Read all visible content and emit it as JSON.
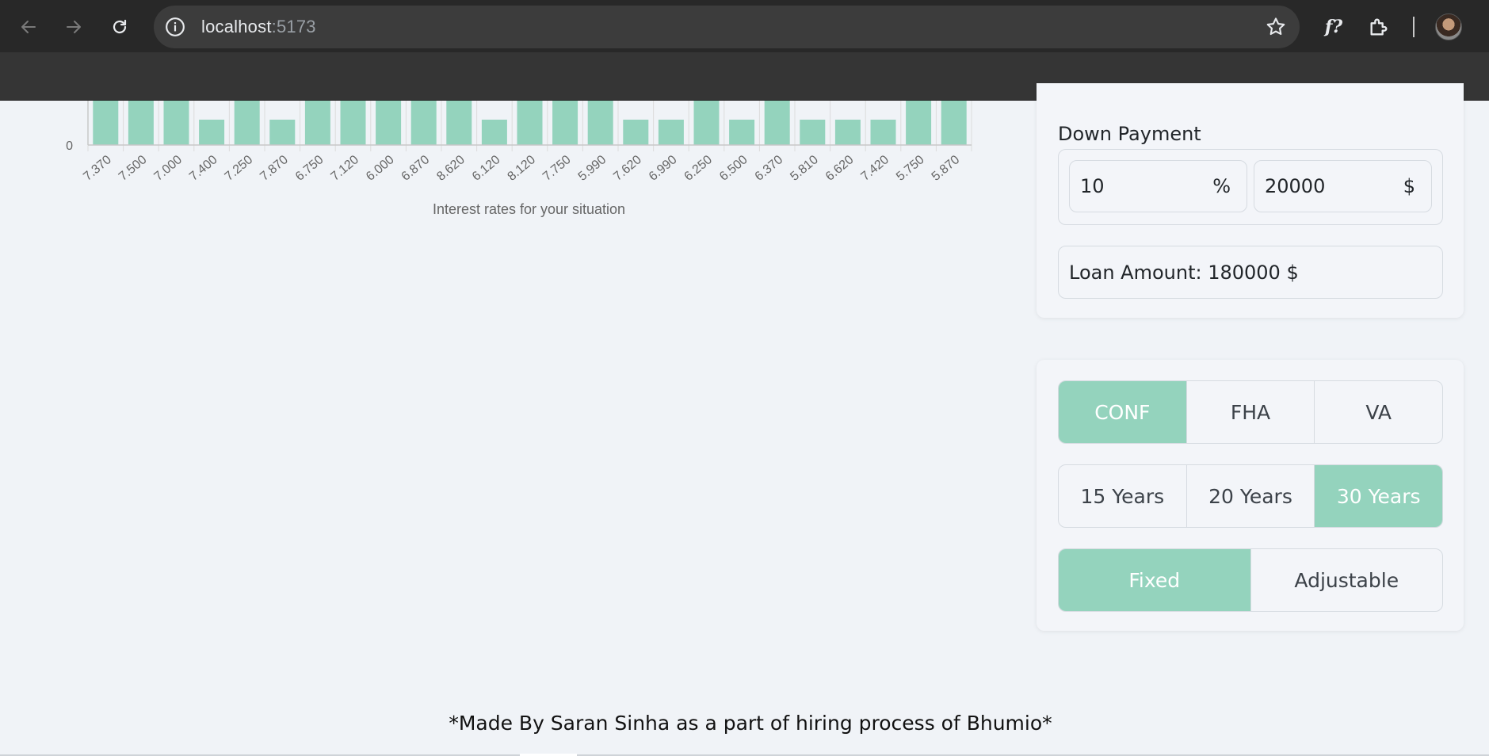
{
  "browser": {
    "url_host": "localhost",
    "url_port": ":5173"
  },
  "chart_data": {
    "type": "bar",
    "xlabel": "Interest rates for your situation",
    "y_ticks": [
      "0"
    ],
    "categories": [
      "7.370",
      "7.500",
      "7.000",
      "7.400",
      "7.250",
      "7.870",
      "6.750",
      "7.120",
      "6.000",
      "6.870",
      "8.620",
      "6.120",
      "8.120",
      "7.750",
      "5.990",
      "7.620",
      "6.990",
      "6.250",
      "6.500",
      "6.370",
      "5.810",
      "6.620",
      "7.420",
      "5.750",
      "5.870"
    ],
    "values": [
      2,
      2,
      2,
      1,
      2,
      1,
      2,
      2,
      2,
      2,
      2,
      1,
      2,
      2,
      2,
      1,
      1,
      2,
      1,
      2,
      1,
      1,
      1,
      2,
      2
    ],
    "bar_color": "#94d3bd"
  },
  "down_payment": {
    "label": "Down Payment",
    "percent_value": "10",
    "percent_unit": "%",
    "amount_value": "20000",
    "amount_unit": "$"
  },
  "loan": {
    "text": "Loan Amount: 180000 $"
  },
  "loan_type": {
    "options": [
      "CONF",
      "FHA",
      "VA"
    ],
    "selected": "CONF"
  },
  "term": {
    "options": [
      "15 Years",
      "20 Years",
      "30 Years"
    ],
    "selected": "30 Years"
  },
  "rate_type": {
    "options": [
      "Fixed",
      "Adjustable"
    ],
    "selected": "Fixed"
  },
  "colors": {
    "accent": "#94d3bd",
    "page_bg": "#f0f3f7"
  },
  "footer": {
    "text": "*Made By Saran Sinha as a part of hiring process of Bhumio*"
  }
}
